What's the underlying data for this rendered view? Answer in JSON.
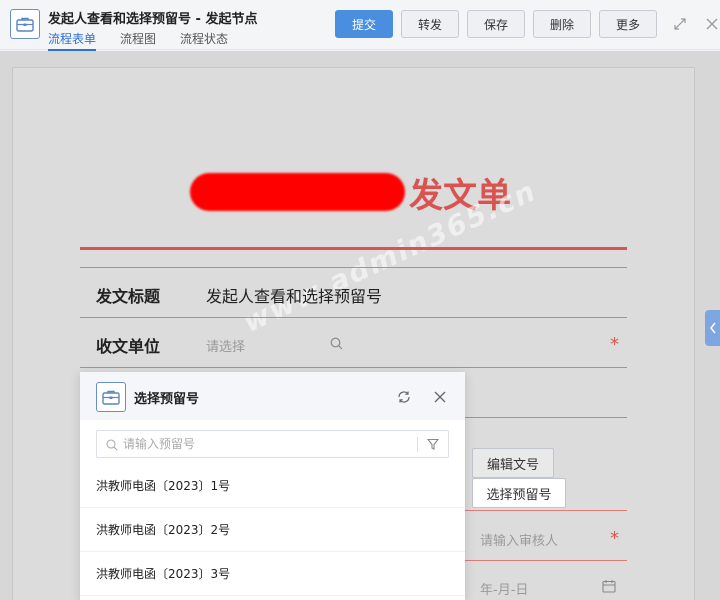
{
  "header": {
    "title": "发起人查看和选择预留号 - 发起节点",
    "tabs": [
      {
        "label": "流程表单",
        "active": true
      },
      {
        "label": "流程图",
        "active": false
      },
      {
        "label": "流程状态",
        "active": false
      }
    ],
    "buttons": {
      "submit": "提交",
      "forward": "转发",
      "save": "保存",
      "delete": "删除",
      "more": "更多"
    }
  },
  "colors": {
    "accent": "#4a8ee0",
    "form_red": "#d9534f",
    "redaction": "#ff0000"
  },
  "document": {
    "title_suffix": "发文单",
    "watermark": "www.admin365.cn",
    "fields": {
      "subject_label": "发文标题",
      "subject_value": "发起人查看和选择预留号",
      "receiver_label": "收文单位",
      "receiver_placeholder": "请选择",
      "reviewer_placeholder": "请输入审核人",
      "date_placeholder": "年-月-日",
      "required_mark": "*"
    },
    "buttons": {
      "edit_number": "编辑文号",
      "select_reserved": "选择预留号"
    }
  },
  "popup": {
    "title": "选择预留号",
    "search_placeholder": "请输入预留号",
    "items": [
      "洪教师电函〔2023〕1号",
      "洪教师电函〔2023〕2号",
      "洪教师电函〔2023〕3号"
    ]
  }
}
